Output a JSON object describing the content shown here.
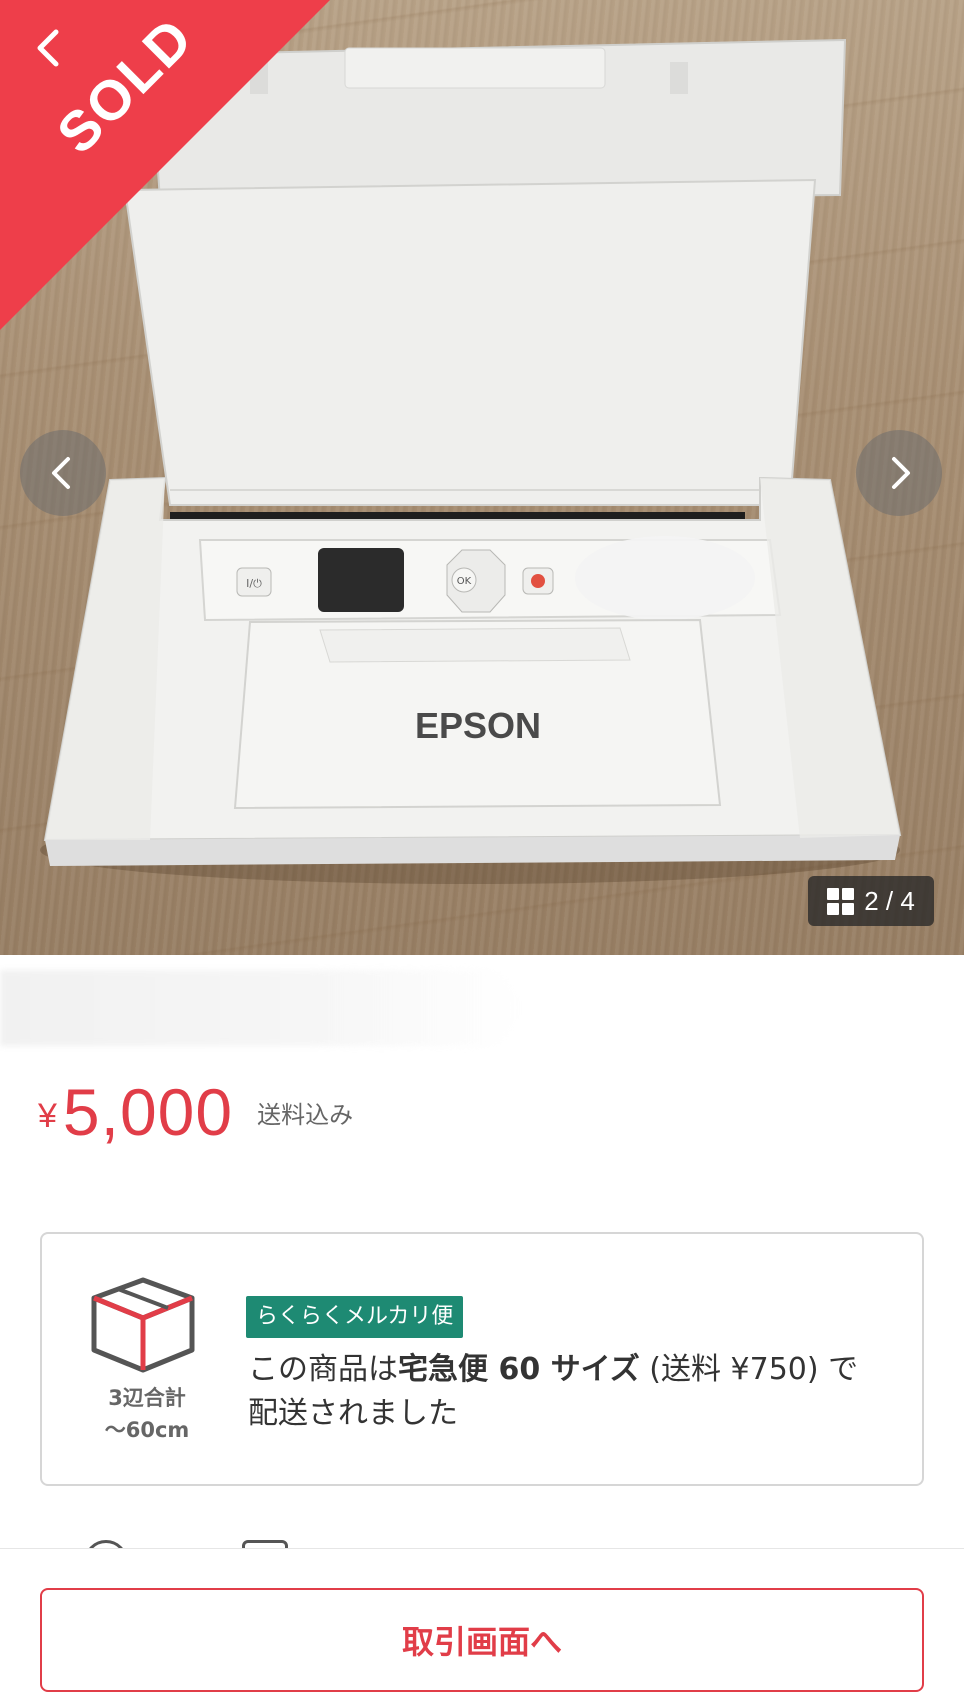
{
  "product": {
    "brand_label": "EPSON",
    "status_ribbon": "SOLD",
    "image_index": "2 / 4"
  },
  "price": {
    "currency_symbol": "¥",
    "amount": "5,000",
    "shipping_included": "送料込み"
  },
  "shipping": {
    "method": "らくらくメルカリ便",
    "size_caption_line1": "3辺合計",
    "size_caption_line2": "～60cm",
    "desc_prefix": "この商品は",
    "desc_bold": "宅急便 60 サイズ",
    "desc_fee": " (送料 ¥750) で",
    "desc_suffix": "配送されました"
  },
  "actions": {
    "trade_button": "取引画面へ"
  },
  "colors": {
    "accent_red": "#e13d48",
    "sold_red": "#ee3e4a",
    "badge_green": "#1e8a73"
  },
  "icons": {
    "back": "chevron-left-icon",
    "prev": "chevron-left-icon",
    "next": "chevron-right-icon",
    "gallery": "grid-icon",
    "package": "box-icon"
  }
}
